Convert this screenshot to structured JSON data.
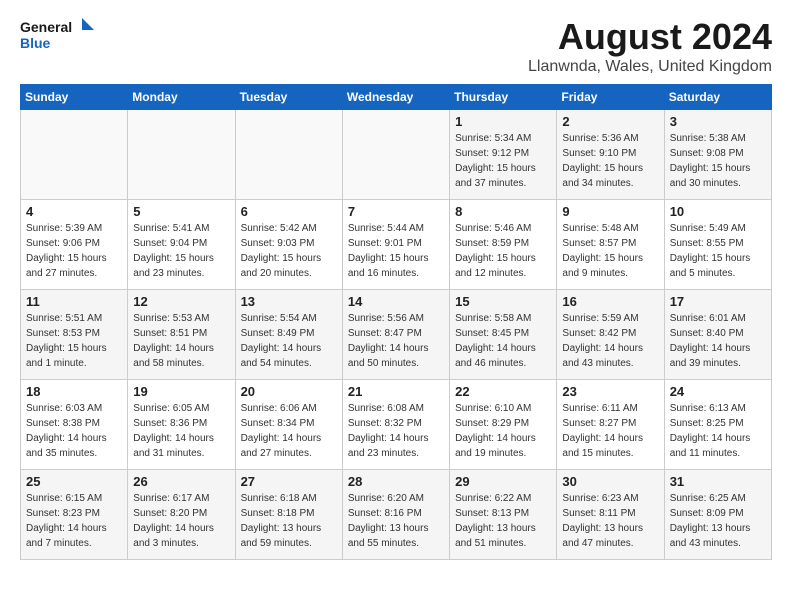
{
  "header": {
    "logo_line1": "General",
    "logo_line2": "Blue",
    "title": "August 2024",
    "subtitle": "Llanwnda, Wales, United Kingdom"
  },
  "weekdays": [
    "Sunday",
    "Monday",
    "Tuesday",
    "Wednesday",
    "Thursday",
    "Friday",
    "Saturday"
  ],
  "weeks": [
    [
      {
        "day": "",
        "info": ""
      },
      {
        "day": "",
        "info": ""
      },
      {
        "day": "",
        "info": ""
      },
      {
        "day": "",
        "info": ""
      },
      {
        "day": "1",
        "info": "Sunrise: 5:34 AM\nSunset: 9:12 PM\nDaylight: 15 hours\nand 37 minutes."
      },
      {
        "day": "2",
        "info": "Sunrise: 5:36 AM\nSunset: 9:10 PM\nDaylight: 15 hours\nand 34 minutes."
      },
      {
        "day": "3",
        "info": "Sunrise: 5:38 AM\nSunset: 9:08 PM\nDaylight: 15 hours\nand 30 minutes."
      }
    ],
    [
      {
        "day": "4",
        "info": "Sunrise: 5:39 AM\nSunset: 9:06 PM\nDaylight: 15 hours\nand 27 minutes."
      },
      {
        "day": "5",
        "info": "Sunrise: 5:41 AM\nSunset: 9:04 PM\nDaylight: 15 hours\nand 23 minutes."
      },
      {
        "day": "6",
        "info": "Sunrise: 5:42 AM\nSunset: 9:03 PM\nDaylight: 15 hours\nand 20 minutes."
      },
      {
        "day": "7",
        "info": "Sunrise: 5:44 AM\nSunset: 9:01 PM\nDaylight: 15 hours\nand 16 minutes."
      },
      {
        "day": "8",
        "info": "Sunrise: 5:46 AM\nSunset: 8:59 PM\nDaylight: 15 hours\nand 12 minutes."
      },
      {
        "day": "9",
        "info": "Sunrise: 5:48 AM\nSunset: 8:57 PM\nDaylight: 15 hours\nand 9 minutes."
      },
      {
        "day": "10",
        "info": "Sunrise: 5:49 AM\nSunset: 8:55 PM\nDaylight: 15 hours\nand 5 minutes."
      }
    ],
    [
      {
        "day": "11",
        "info": "Sunrise: 5:51 AM\nSunset: 8:53 PM\nDaylight: 15 hours\nand 1 minute."
      },
      {
        "day": "12",
        "info": "Sunrise: 5:53 AM\nSunset: 8:51 PM\nDaylight: 14 hours\nand 58 minutes."
      },
      {
        "day": "13",
        "info": "Sunrise: 5:54 AM\nSunset: 8:49 PM\nDaylight: 14 hours\nand 54 minutes."
      },
      {
        "day": "14",
        "info": "Sunrise: 5:56 AM\nSunset: 8:47 PM\nDaylight: 14 hours\nand 50 minutes."
      },
      {
        "day": "15",
        "info": "Sunrise: 5:58 AM\nSunset: 8:45 PM\nDaylight: 14 hours\nand 46 minutes."
      },
      {
        "day": "16",
        "info": "Sunrise: 5:59 AM\nSunset: 8:42 PM\nDaylight: 14 hours\nand 43 minutes."
      },
      {
        "day": "17",
        "info": "Sunrise: 6:01 AM\nSunset: 8:40 PM\nDaylight: 14 hours\nand 39 minutes."
      }
    ],
    [
      {
        "day": "18",
        "info": "Sunrise: 6:03 AM\nSunset: 8:38 PM\nDaylight: 14 hours\nand 35 minutes."
      },
      {
        "day": "19",
        "info": "Sunrise: 6:05 AM\nSunset: 8:36 PM\nDaylight: 14 hours\nand 31 minutes."
      },
      {
        "day": "20",
        "info": "Sunrise: 6:06 AM\nSunset: 8:34 PM\nDaylight: 14 hours\nand 27 minutes."
      },
      {
        "day": "21",
        "info": "Sunrise: 6:08 AM\nSunset: 8:32 PM\nDaylight: 14 hours\nand 23 minutes."
      },
      {
        "day": "22",
        "info": "Sunrise: 6:10 AM\nSunset: 8:29 PM\nDaylight: 14 hours\nand 19 minutes."
      },
      {
        "day": "23",
        "info": "Sunrise: 6:11 AM\nSunset: 8:27 PM\nDaylight: 14 hours\nand 15 minutes."
      },
      {
        "day": "24",
        "info": "Sunrise: 6:13 AM\nSunset: 8:25 PM\nDaylight: 14 hours\nand 11 minutes."
      }
    ],
    [
      {
        "day": "25",
        "info": "Sunrise: 6:15 AM\nSunset: 8:23 PM\nDaylight: 14 hours\nand 7 minutes."
      },
      {
        "day": "26",
        "info": "Sunrise: 6:17 AM\nSunset: 8:20 PM\nDaylight: 14 hours\nand 3 minutes."
      },
      {
        "day": "27",
        "info": "Sunrise: 6:18 AM\nSunset: 8:18 PM\nDaylight: 13 hours\nand 59 minutes."
      },
      {
        "day": "28",
        "info": "Sunrise: 6:20 AM\nSunset: 8:16 PM\nDaylight: 13 hours\nand 55 minutes."
      },
      {
        "day": "29",
        "info": "Sunrise: 6:22 AM\nSunset: 8:13 PM\nDaylight: 13 hours\nand 51 minutes."
      },
      {
        "day": "30",
        "info": "Sunrise: 6:23 AM\nSunset: 8:11 PM\nDaylight: 13 hours\nand 47 minutes."
      },
      {
        "day": "31",
        "info": "Sunrise: 6:25 AM\nSunset: 8:09 PM\nDaylight: 13 hours\nand 43 minutes."
      }
    ]
  ]
}
